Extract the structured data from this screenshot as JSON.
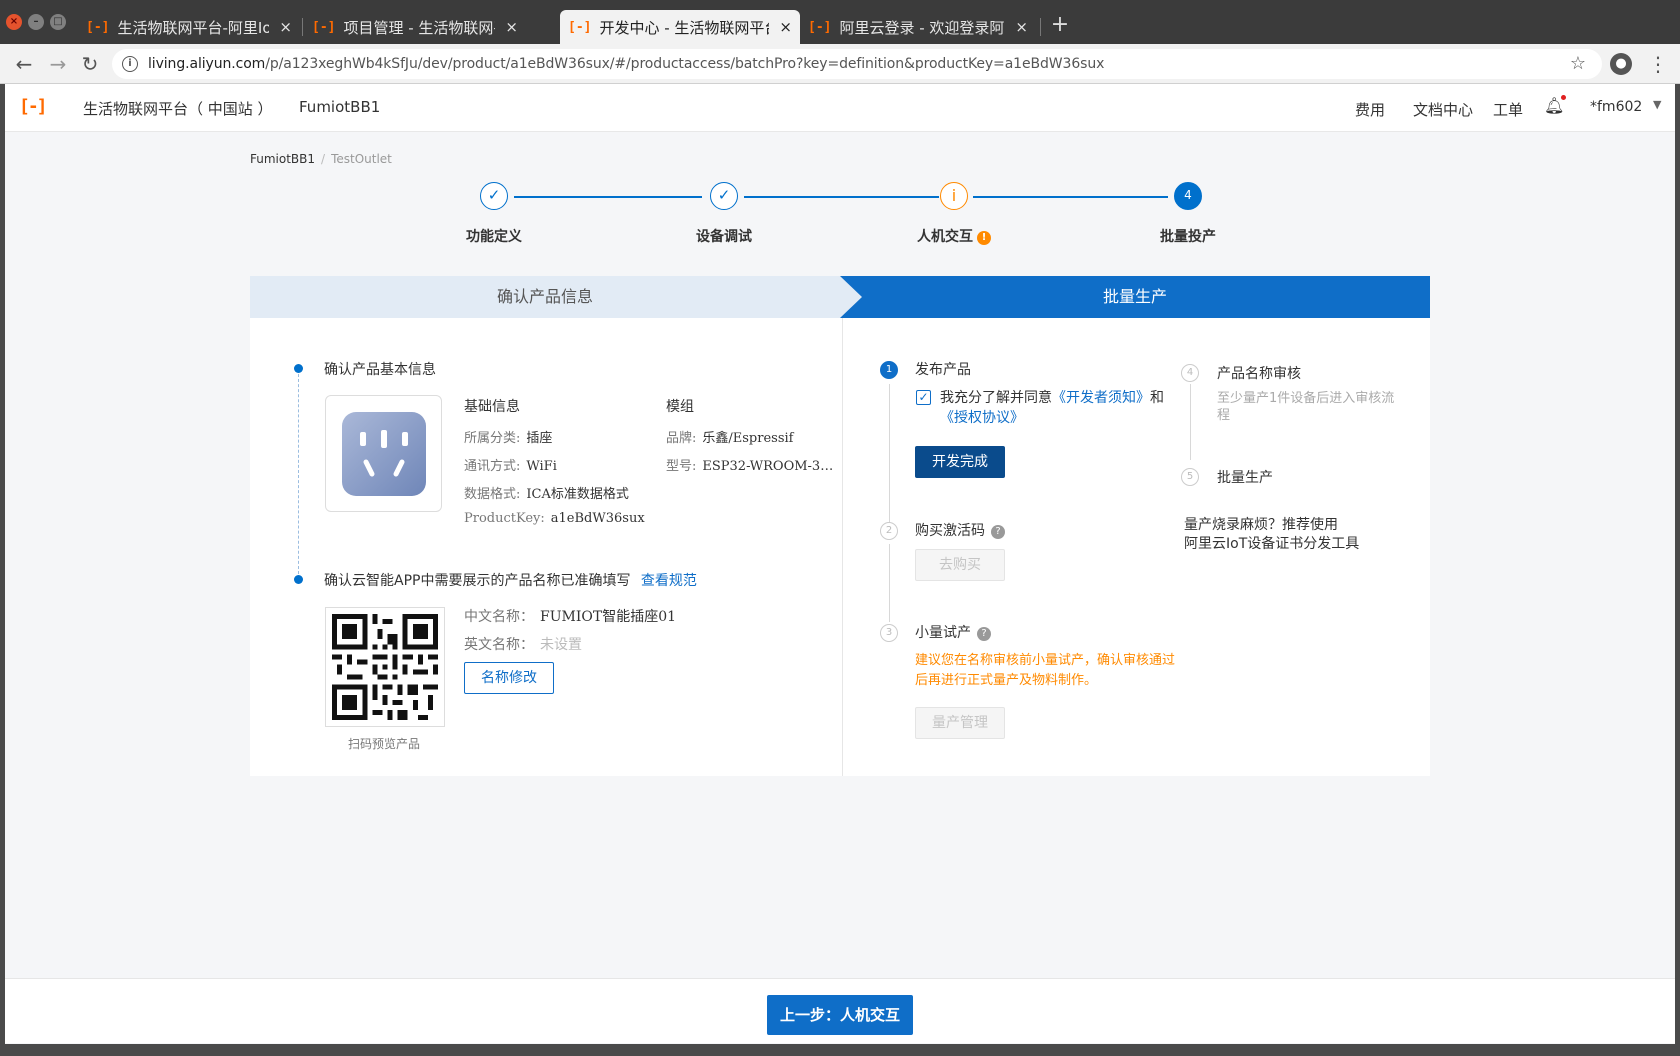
{
  "browser": {
    "tabs": [
      {
        "favicon": "[-]",
        "title": "生活物联网平台-阿里IoT生",
        "close": "×"
      },
      {
        "favicon": "[-]",
        "title": "项目管理 - 生活物联网平台",
        "close": "×"
      },
      {
        "favicon": "[-]",
        "title": "开发中心 - 生活物联网平台",
        "close": "×"
      },
      {
        "favicon": "[-]",
        "title": "阿里云登录 - 欢迎登录阿里",
        "close": "×"
      }
    ],
    "new_tab": "+",
    "url_host": "living.aliyun.com",
    "url_path": "/p/a123xeghWb4kSfJu/dev/product/a1eBdW36sux/#/productaccess/batchPro?key=definition&productKey=a1eBdW36sux"
  },
  "header": {
    "logo": "[-]",
    "brand": "生活物联网平台（ 中国站 ）",
    "project": "FumiotBB1",
    "nav": [
      "费用",
      "文档中心",
      "工单"
    ],
    "user": "*fm602"
  },
  "breadcrumb": {
    "root": "FumiotBB1",
    "sep": "/",
    "current": "TestOutlet"
  },
  "steps": [
    {
      "label": "功能定义",
      "state": "done",
      "mark": "✓"
    },
    {
      "label": "设备调试",
      "state": "done",
      "mark": "✓"
    },
    {
      "label": "人机交互",
      "state": "warning",
      "mark": "i",
      "badge": "!"
    },
    {
      "label": "批量投产",
      "state": "current",
      "mark": "4"
    }
  ],
  "panel": {
    "left_tab": "确认产品信息",
    "right_tab": "批量生产",
    "section1": {
      "title": "确认产品基本信息",
      "basic_head": "基础信息",
      "module_head": "模组",
      "category_k": "所属分类:",
      "category_v": "插座",
      "comm_k": "通讯方式:",
      "comm_v": "WiFi",
      "format_k": "数据格式:",
      "format_v": "ICA标准数据格式",
      "pk_k": "ProductKey:",
      "pk_v": "a1eBdW36sux",
      "brand_k": "品牌:",
      "brand_v": "乐鑫/Espressif",
      "model_k": "型号:",
      "model_v": "ESP32-WROOM-3…"
    },
    "section2": {
      "title": "确认云智能APP中需要展示的产品名称已准确填写",
      "link": "查看规范",
      "cn_k": "中文名称：",
      "cn_v": "FUMIOT智能插座01",
      "en_k": "英文名称：",
      "en_v": "未设置",
      "rename_button": "名称修改",
      "qr_caption": "扫码预览产品"
    },
    "right": {
      "step1": {
        "num": "1",
        "title": "发布产品",
        "agree_prefix": "我充分了解并同意",
        "agree_link1": "《开发者须知》",
        "agree_mid": "和",
        "agree_link2": "《授权协议》",
        "button": "开发完成"
      },
      "step2": {
        "num": "2",
        "title": "购买激活码",
        "button": "去购买"
      },
      "step3": {
        "num": "3",
        "title": "小量试产",
        "warn": "建议您在名称审核前小量试产，确认审核通过后再进行正式量产及物料制作。",
        "button": "量产管理"
      },
      "step4": {
        "num": "4",
        "title": "产品名称审核",
        "desc": "至少量产1件设备后进入审核流程"
      },
      "step5": {
        "num": "5",
        "title": "批量生产"
      },
      "tip": "量产烧录麻烦？推荐使用",
      "tip_link": "阿里云IoT设备证书分发工具"
    }
  },
  "footer": {
    "back_button": "上一步：人机交互"
  }
}
